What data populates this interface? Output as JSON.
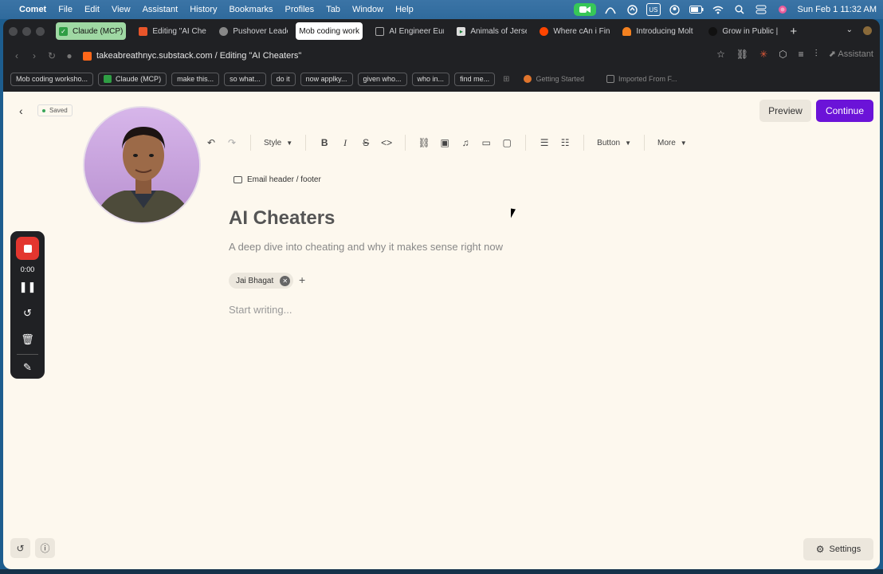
{
  "menubar": {
    "app": "Comet",
    "items": [
      "File",
      "Edit",
      "View",
      "Assistant",
      "History",
      "Bookmarks",
      "Profiles",
      "Tab",
      "Window",
      "Help"
    ],
    "input_source": "US",
    "datetime": "Sun Feb 1  11:32 AM"
  },
  "tabs": [
    {
      "label": "Claude (MCP)",
      "icon": "check-icon"
    },
    {
      "label": "Editing \"AI Cheat",
      "icon": "substack-icon"
    },
    {
      "label": "Pushover Leader",
      "icon": "globe-icon"
    },
    {
      "label": "Mob coding works",
      "icon": "none"
    },
    {
      "label": "AI Engineer Euro",
      "icon": "mail-icon"
    },
    {
      "label": "Animals of Jerse",
      "icon": "play-icon"
    },
    {
      "label": "Where cAn i Find",
      "icon": "reddit-icon"
    },
    {
      "label": "Introducing Molt",
      "icon": "cloud-icon"
    },
    {
      "label": "Grow in Public | S",
      "icon": "dot-icon"
    }
  ],
  "address": {
    "url": "takeabreathnyc.substack.com / Editing \"AI Cheaters\"",
    "assistant_label": "Assistant"
  },
  "bookmarks": [
    "Mob coding worksho...",
    "Claude (MCP)",
    "make this...",
    "so what...",
    "do it",
    "now applky...",
    "given who...",
    "who in...",
    "find me...",
    "Getting Started",
    "Imported From F..."
  ],
  "editor": {
    "saved_label": "Saved",
    "preview_label": "Preview",
    "continue_label": "Continue",
    "style_label": "Style",
    "button_label": "Button",
    "more_label": "More",
    "email_header_label": "Email header / footer",
    "title": "AI Cheaters",
    "subtitle": "A deep dive into cheating and why it makes sense right now",
    "author": "Jai Bhagat",
    "body_placeholder": "Start writing...",
    "settings_label": "Settings"
  },
  "recorder": {
    "time": "0:00"
  },
  "colors": {
    "accent": "#6b13d8",
    "record": "#e3362f",
    "page_bg": "#fdf8ee"
  }
}
